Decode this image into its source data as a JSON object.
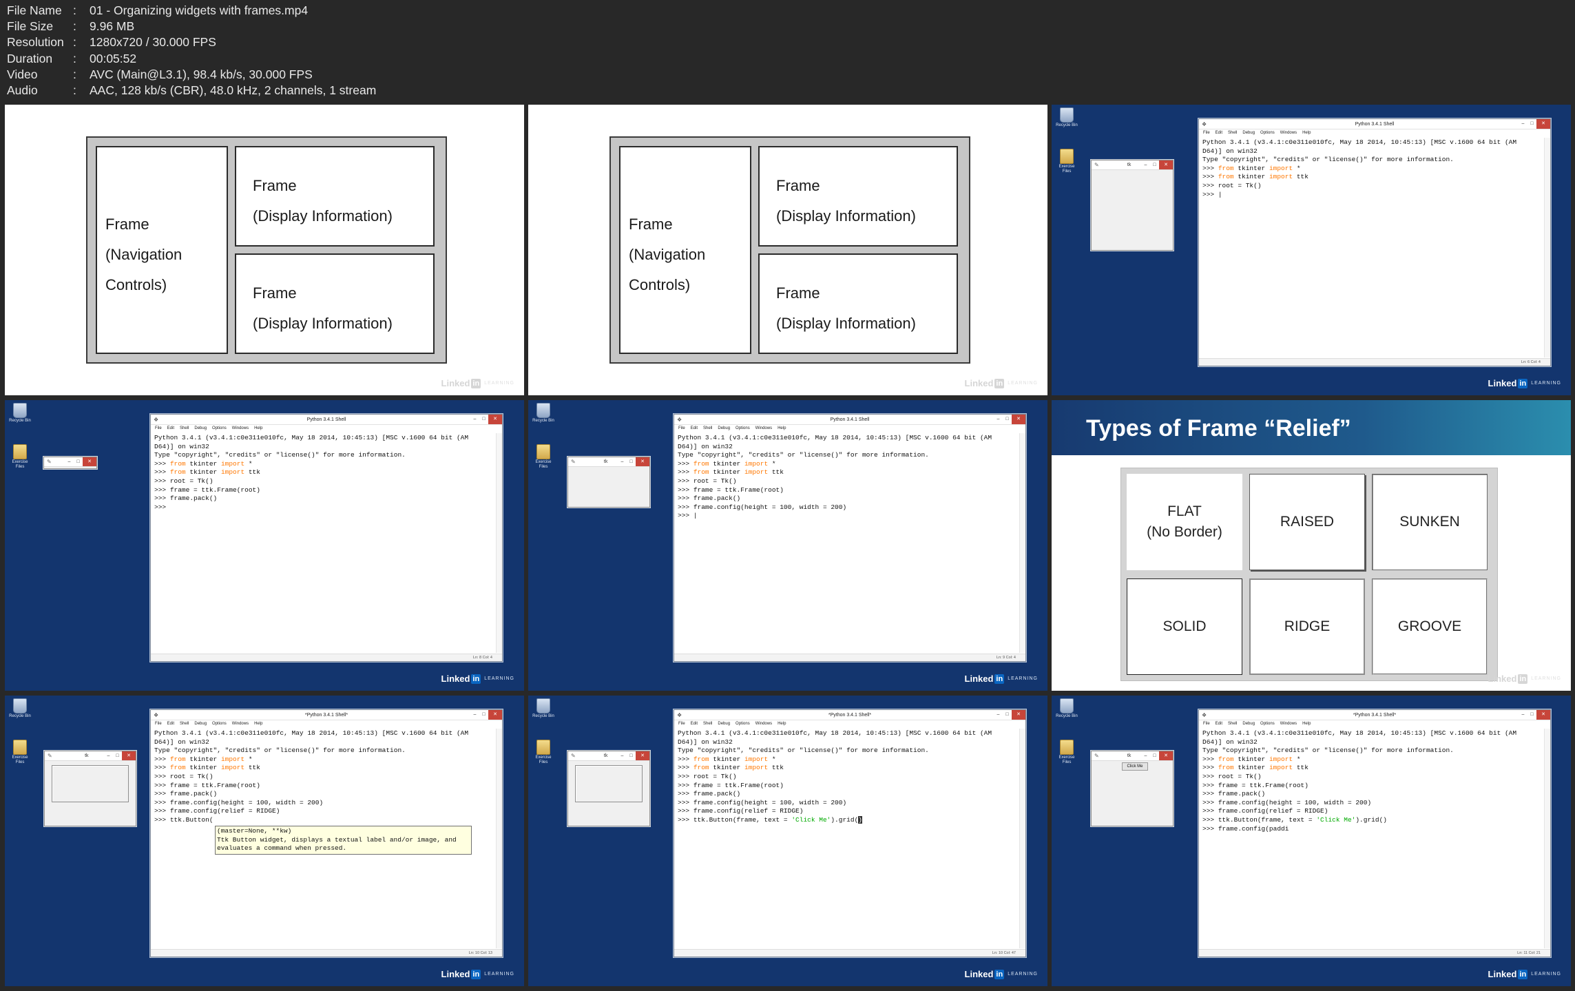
{
  "metadata": [
    {
      "key": "File Name",
      "value": "01 - Organizing widgets with frames.mp4"
    },
    {
      "key": "File Size",
      "value": "9.96 MB"
    },
    {
      "key": "Resolution",
      "value": "1280x720 / 30.000 FPS"
    },
    {
      "key": "Duration",
      "value": "00:05:52"
    },
    {
      "key": "Video",
      "value": "AVC (Main@L3.1), 98.4 kb/s, 30.000 FPS"
    },
    {
      "key": "Audio",
      "value": "AAC, 128 kb/s (CBR), 48.0 kHz, 2 channels, 1 stream"
    }
  ],
  "diagram": {
    "nav_line1": "Frame",
    "nav_line2": "(Navigation",
    "nav_line3": "Controls)",
    "display_line1": "Frame",
    "display_line2": "(Display Information)"
  },
  "logo": {
    "linked": "Linked",
    "in": "in",
    "learning": "LEARNING"
  },
  "desktop": {
    "recycle_bin": "Recycle Bin",
    "exercise_files": "Exercise Files"
  },
  "tk": {
    "title": "tk",
    "button": "Click Me"
  },
  "shell": {
    "title": "Python 3.4.1 Shell",
    "title_modified": "*Python 3.4.1 Shell*",
    "menu": [
      "File",
      "Edit",
      "Shell",
      "Debug",
      "Options",
      "Windows",
      "Help"
    ],
    "banner1": "Python 3.4.1 (v3.4.1:c0e311e010fc, May 18 2014, 10:45:13) [MSC v.1600 64 bit (AM",
    "banner2": "D64)] on win32",
    "banner3": "Type \"copyright\", \"credits\" or \"license()\" for more information.",
    "prompt": ">>> ",
    "kw_from": "from",
    "kw_import": "import",
    "mod_tkinter": " tkinter ",
    "star": " *",
    "ttk": " ttk",
    "root": "root = Tk()",
    "frame_create": "frame = ttk.Frame(root)",
    "frame_pack": "frame.pack()",
    "frame_config_size": "frame.config(height = 100, width = 200)",
    "frame_config_relief": "frame.config(relief = RIDGE)",
    "button_partial": "ttk.Button(",
    "button_pre": "ttk.Button(frame, text = ",
    "button_str": "'Click Me'",
    "button_post_grid": ").grid(",
    "button_grid_cursor": ")",
    "button_post_full": ").grid()",
    "config_padding": "frame.config(paddi",
    "calltip1": "(master=None, **kw)",
    "calltip2": "Ttk Button widget, displays a textual label and/or image, and",
    "calltip3": "evaluates a command when pressed.",
    "status": [
      "Ln: 6 Col: 4",
      "Ln: 8 Col: 4",
      "Ln: 9 Col: 4",
      "Ln: 10 Col: 13",
      "Ln: 10 Col: 47",
      "Ln: 11 Col: 21"
    ]
  },
  "relief": {
    "title": "Types of Frame “Relief”",
    "flat1": "FLAT",
    "flat2": "(No Border)",
    "raised": "RAISED",
    "sunken": "SUNKEN",
    "solid": "SOLID",
    "ridge": "RIDGE",
    "groove": "GROOVE"
  },
  "colors": {
    "background": "#282828",
    "desktop": "#13356e",
    "keyword": "#ff7700",
    "string": "#00aa00",
    "banner": "#1f5a8c"
  }
}
